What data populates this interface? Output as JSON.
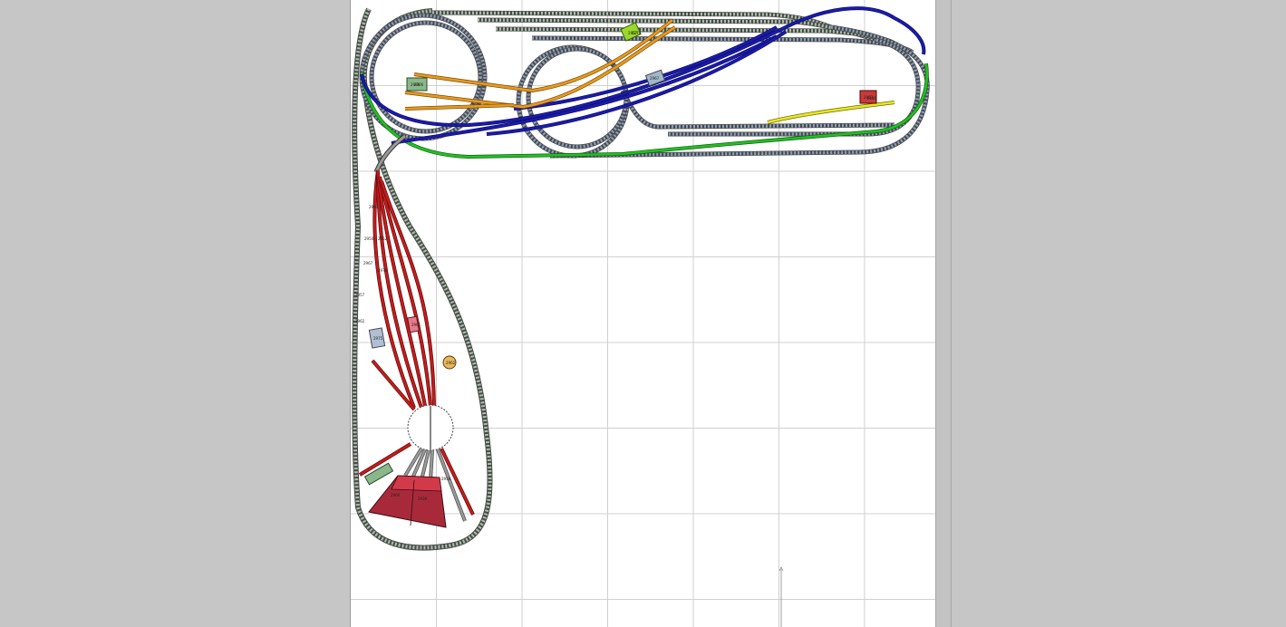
{
  "layout_plan": {
    "track_labels": [
      "2999",
      "2950",
      "2952",
      "2967",
      "2975",
      "2957",
      "2962",
      "2958",
      "2960",
      "2930",
      "2006",
      "6180",
      "6270"
    ],
    "structure_labels": [
      "2957",
      "2967",
      "2999",
      "2963",
      "2975",
      "2961",
      "2962"
    ],
    "colors": {
      "background": "#c6c6c6",
      "canvas": "#ffffff",
      "grid": "#d0d0d0",
      "track_blue_line": "#1c1ca8",
      "track_green_line": "#22c022",
      "track_orange_line": "#e89a1c",
      "track_yellow_line": "#e8e820",
      "track_red_yard": "#c41c1c",
      "track_outer_loop": "#a8c0a8",
      "track_steel": "#8aa0c0",
      "roundhouse": "#a82a3a"
    }
  }
}
